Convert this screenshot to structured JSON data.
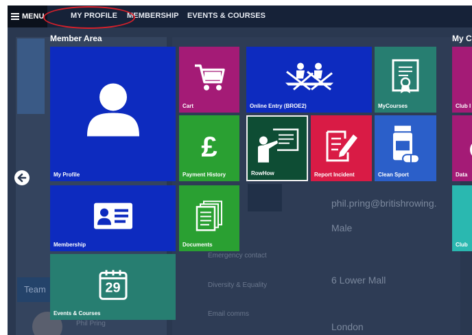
{
  "nav": {
    "menu_label": "MENU",
    "links": [
      "MY PROFILE",
      "MEMBERSHIP",
      "EVENTS & COURSES"
    ]
  },
  "overlay": {
    "section_title": "Member Area",
    "right_section_title": "My C",
    "tiles": {
      "my_profile": "My Profile",
      "cart": "Cart",
      "online_entry": "Online Entry (BROE2)",
      "mycourses": "MyCourses",
      "club": "Club I",
      "payment_history": "Payment History",
      "rowhow": "RowHow",
      "report_incident": "Report Incident",
      "clean_sport": "Clean Sport",
      "data": "Data",
      "membership": "Membership",
      "documents": "Documents",
      "club2": "Club",
      "events_courses": "Events & Courses",
      "calendar_day": "29"
    }
  },
  "background": {
    "email": "phil.pring@britishrowing.",
    "gender": "Male",
    "address_line": "6 Lower Mall",
    "city": "London",
    "menu_items": [
      "Emergency contact",
      "Diversity & Equality",
      "Email comms"
    ],
    "team_label": "Team",
    "name_fragment": "Phil Pring"
  },
  "colors": {
    "blue": "#0d2bbf",
    "magenta": "#a41b76",
    "green": "#2aa032",
    "teal": "#277e71",
    "dark_green": "#0e4d34",
    "red": "#d91b45",
    "sport_blue": "#2b5fc9",
    "highlight_ring": "#d8202a"
  }
}
